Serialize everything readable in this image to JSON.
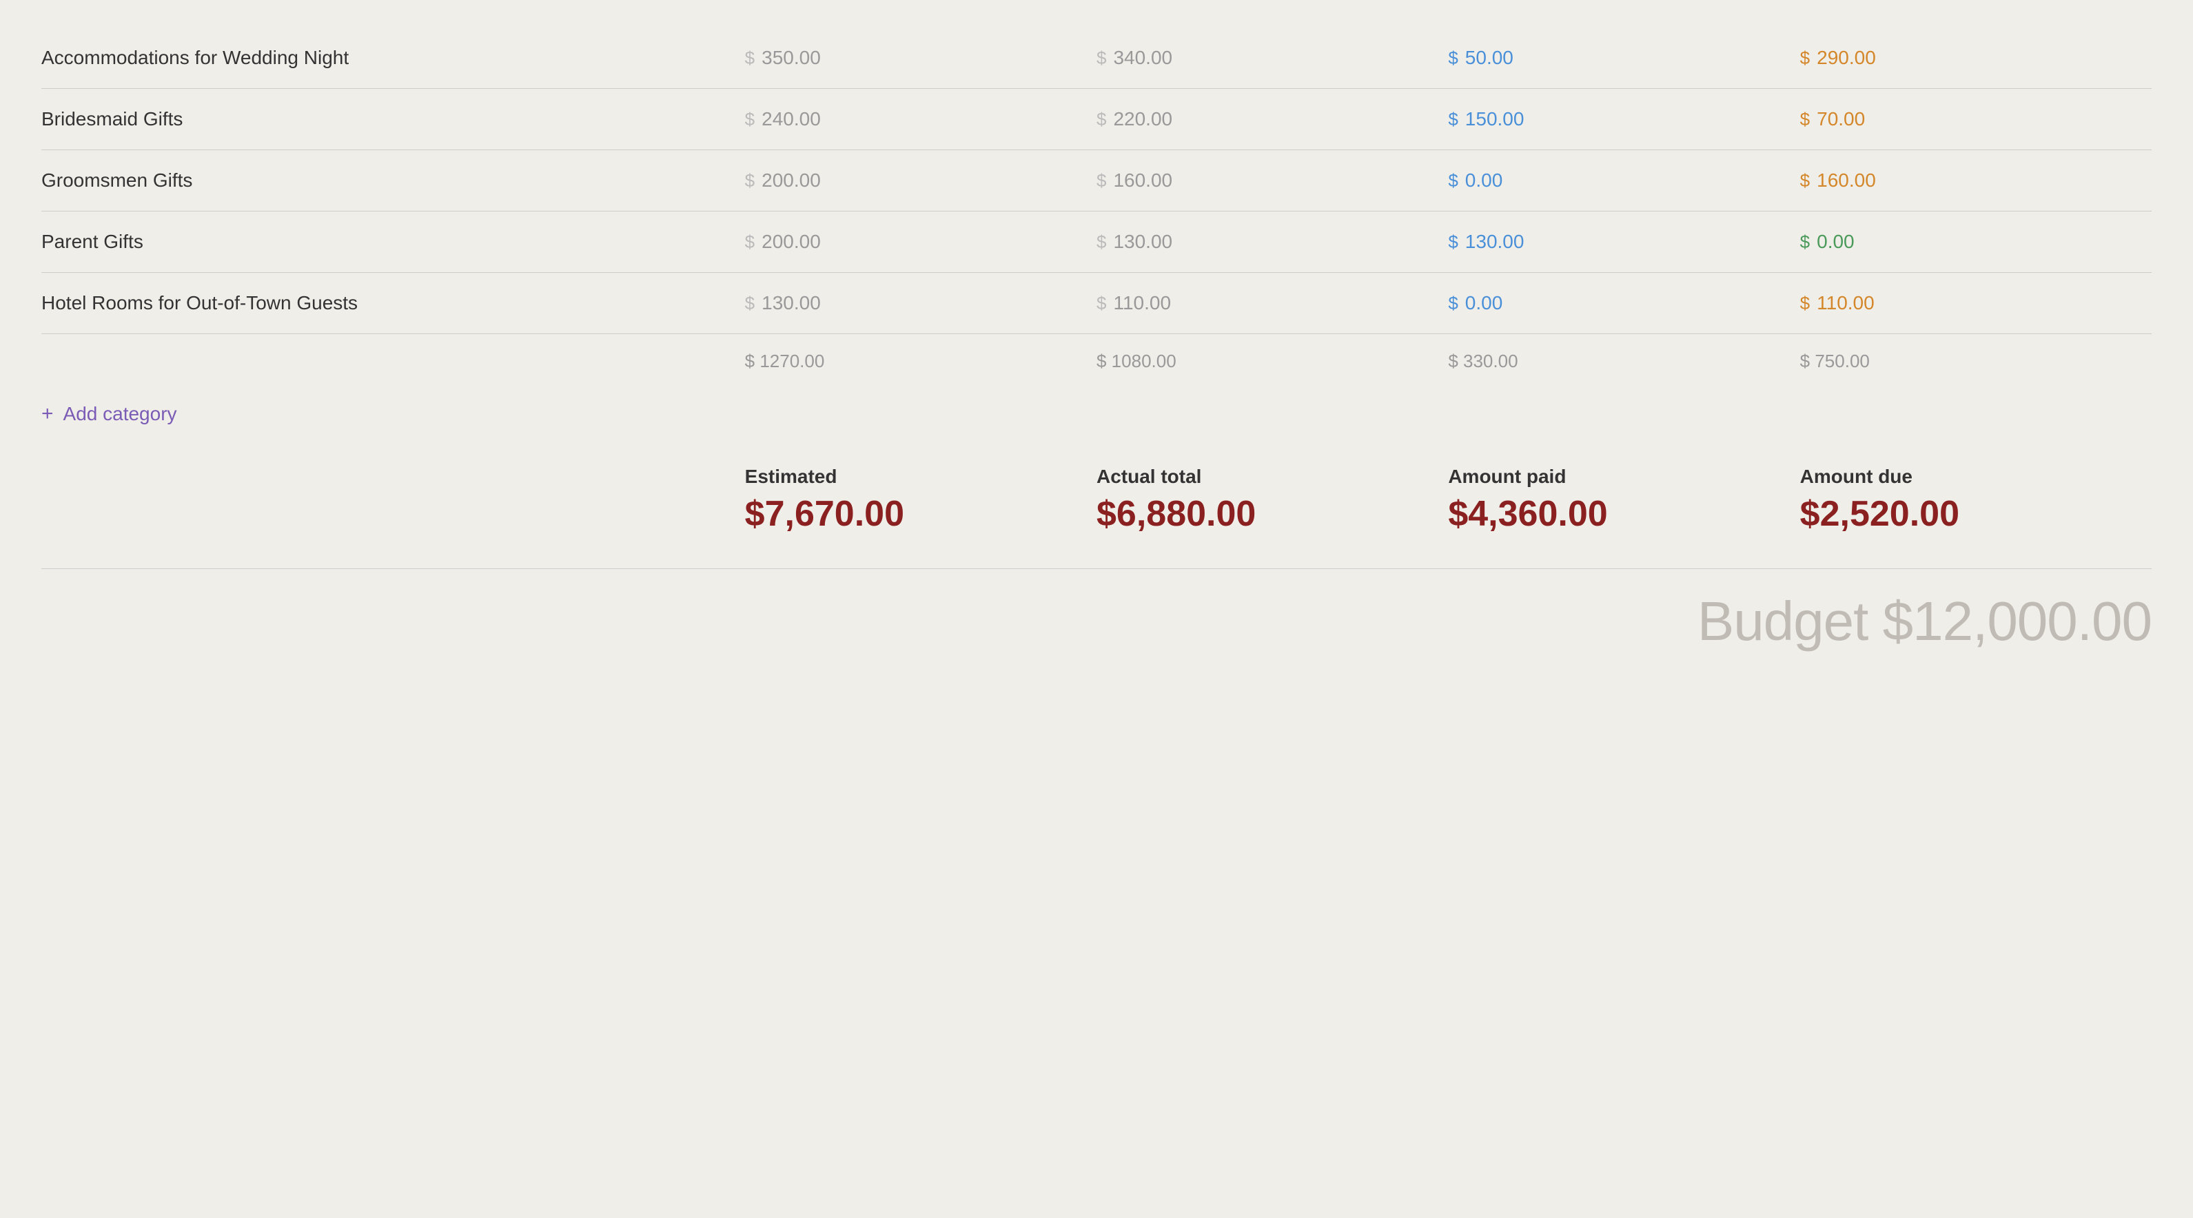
{
  "rows": [
    {
      "label": "Accommodations for Wedding Night",
      "estimated": "350.00",
      "actual": "340.00",
      "paid": "50.00",
      "due": "290.00",
      "paid_color": "blue",
      "due_color": "orange"
    },
    {
      "label": "Bridesmaid Gifts",
      "estimated": "240.00",
      "actual": "220.00",
      "paid": "150.00",
      "due": "70.00",
      "paid_color": "blue",
      "due_color": "orange"
    },
    {
      "label": "Groomsmen Gifts",
      "estimated": "200.00",
      "actual": "160.00",
      "paid": "0.00",
      "due": "160.00",
      "paid_color": "blue",
      "due_color": "orange"
    },
    {
      "label": "Parent Gifts",
      "estimated": "200.00",
      "actual": "130.00",
      "paid": "130.00",
      "due": "0.00",
      "paid_color": "blue",
      "due_color": "green"
    },
    {
      "label": "Hotel Rooms for Out-of-Town Guests",
      "estimated": "130.00",
      "actual": "110.00",
      "paid": "0.00",
      "due": "110.00",
      "paid_color": "blue",
      "due_color": "orange"
    }
  ],
  "totals": {
    "estimated": "$ 1270.00",
    "actual": "$ 1080.00",
    "paid": "$ 330.00",
    "due": "$ 750.00"
  },
  "add_category_label": "Add category",
  "summary": {
    "estimated_label": "Estimated",
    "estimated_value": "$7,670.00",
    "actual_label": "Actual total",
    "actual_value": "$6,880.00",
    "paid_label": "Amount paid",
    "paid_value": "$4,360.00",
    "due_label": "Amount due",
    "due_value": "$2,520.00"
  },
  "budget_label": "Budget $12,000.00"
}
